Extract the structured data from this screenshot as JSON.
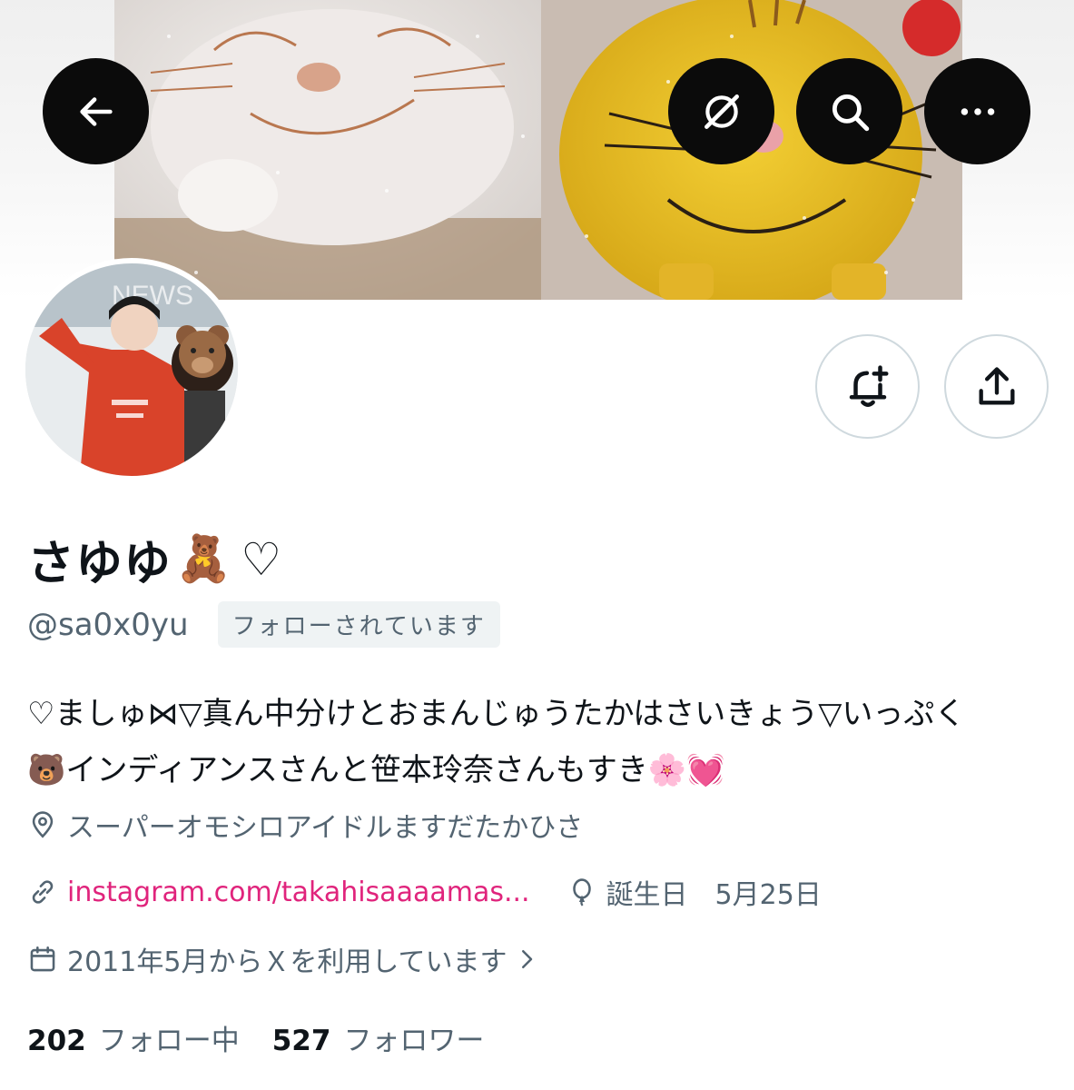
{
  "profile": {
    "display_name": "さゆゆ",
    "name_emoji_1": "🧸",
    "name_emoji_2": "♡",
    "handle": "@sa0x0yu",
    "follows_you_badge": "フォローされています",
    "bio_line_1": "♡ましゅ⋈▽真ん中分けとおまんじゅうたかはさいきょう▽いっぷく",
    "bio_line_2": "🐻インディアンスさんと笹本玲奈さんもすき🌸💓",
    "location": "スーパーオモシロアイドルますだたかひさ",
    "website": "instagram.com/takahisaaaamas...",
    "birthday": "誕生日　5月25日",
    "joined": "2011年5月からＸを利用しています",
    "following_count": "202",
    "following_label": "フォロー中",
    "followers_count": "527",
    "followers_label": "フォロワー"
  },
  "icons": {
    "back": "arrow-left-icon",
    "grok": "grok-icon",
    "search": "search-icon",
    "more": "more-horizontal-icon",
    "notify": "bell-plus-icon",
    "share": "share-icon",
    "location": "location-pin-icon",
    "link": "link-icon",
    "birthday": "balloon-icon",
    "calendar": "calendar-icon",
    "chevron": "chevron-right-icon"
  },
  "colors": {
    "link": "#e0247c",
    "secondary_text": "#536471",
    "primary_text": "#0f1419"
  }
}
